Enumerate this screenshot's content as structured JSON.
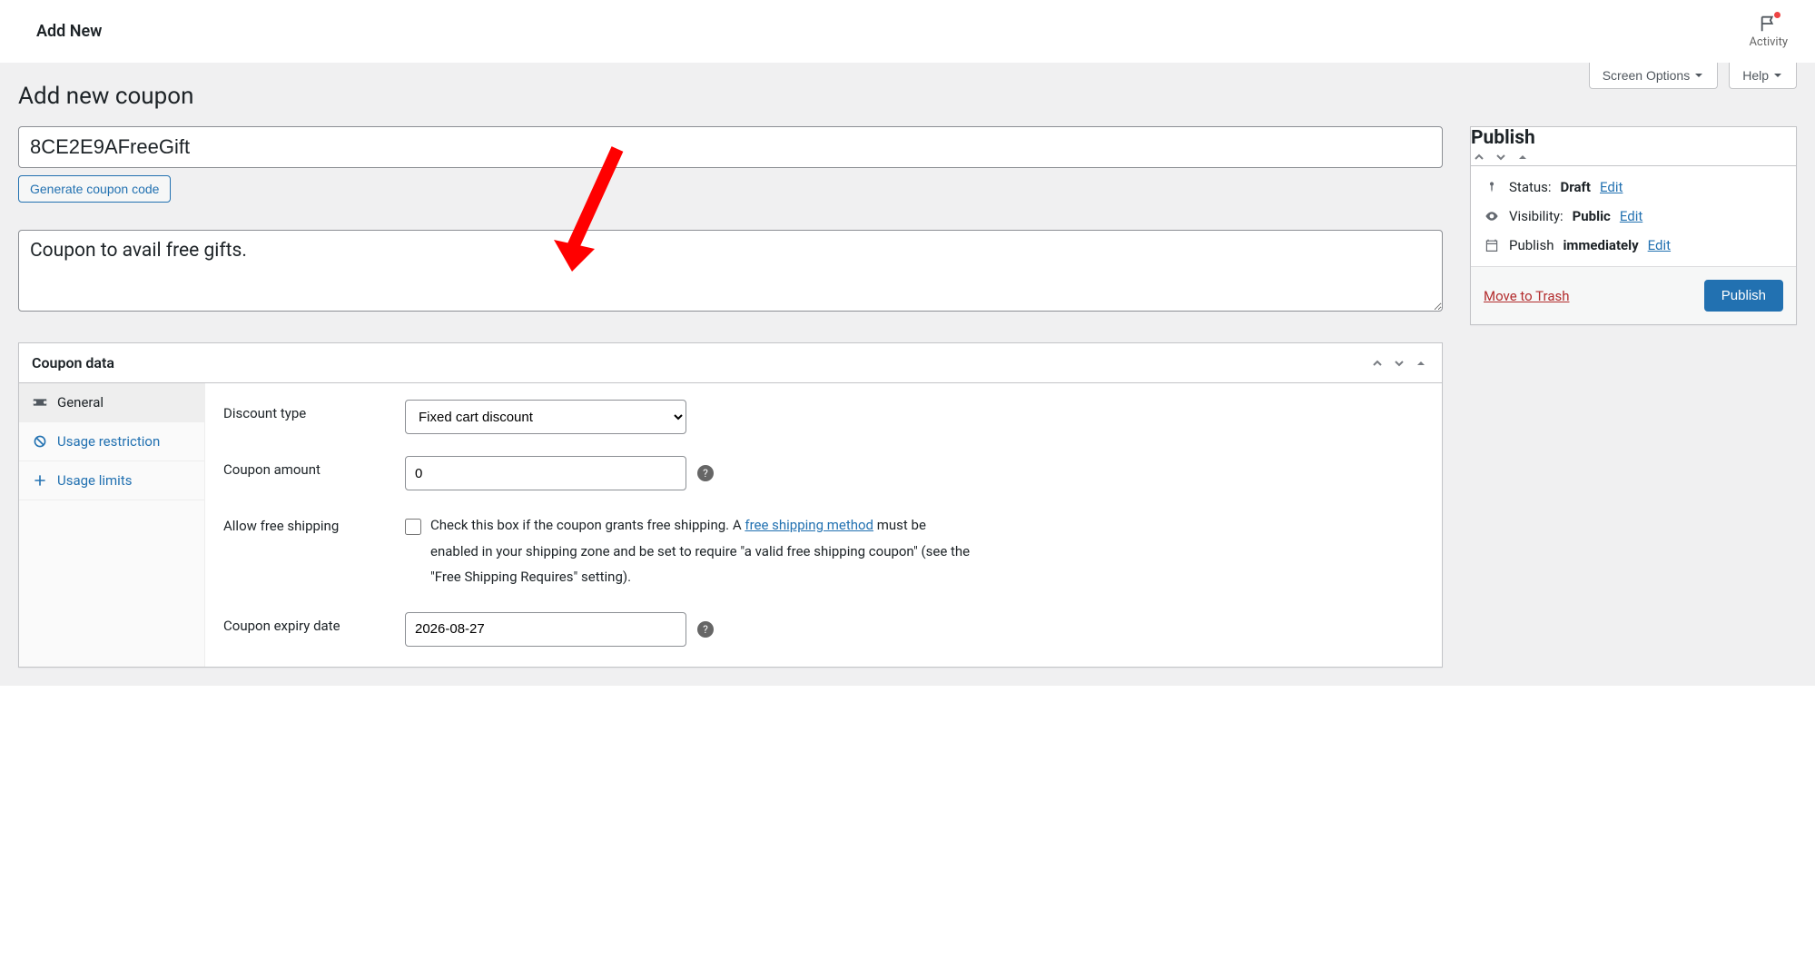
{
  "header": {
    "title": "Add New",
    "activity_label": "Activity"
  },
  "screen_meta": {
    "screen_options": "Screen Options",
    "help": "Help"
  },
  "page": {
    "heading": "Add new coupon",
    "coupon_code": "8CE2E9AFreeGift",
    "generate_button": "Generate coupon code",
    "description": "Coupon to avail free gifts."
  },
  "coupon_data": {
    "title": "Coupon data",
    "tabs": [
      {
        "label": "General",
        "icon": "ticket-icon",
        "active": true
      },
      {
        "label": "Usage restriction",
        "icon": "ban-icon",
        "active": false
      },
      {
        "label": "Usage limits",
        "icon": "arrows-icon",
        "active": false
      }
    ],
    "fields": {
      "discount_type": {
        "label": "Discount type",
        "value": "Fixed cart discount"
      },
      "coupon_amount": {
        "label": "Coupon amount",
        "value": "0"
      },
      "free_shipping": {
        "label": "Allow free shipping",
        "checked": false,
        "text_before": "Check this box if the coupon grants free shipping. A ",
        "link_text": "free shipping method",
        "text_after": " must be enabled in your shipping zone and be set to require \"a valid free shipping coupon\" (see the \"Free Shipping Requires\" setting)."
      },
      "expiry": {
        "label": "Coupon expiry date",
        "value": "2026-08-27"
      }
    }
  },
  "publish": {
    "title": "Publish",
    "status_label": "Status:",
    "status_value": "Draft",
    "visibility_label": "Visibility:",
    "visibility_value": "Public",
    "schedule_label": "Publish",
    "schedule_value": "immediately",
    "edit": "Edit",
    "trash": "Move to Trash",
    "button": "Publish"
  }
}
